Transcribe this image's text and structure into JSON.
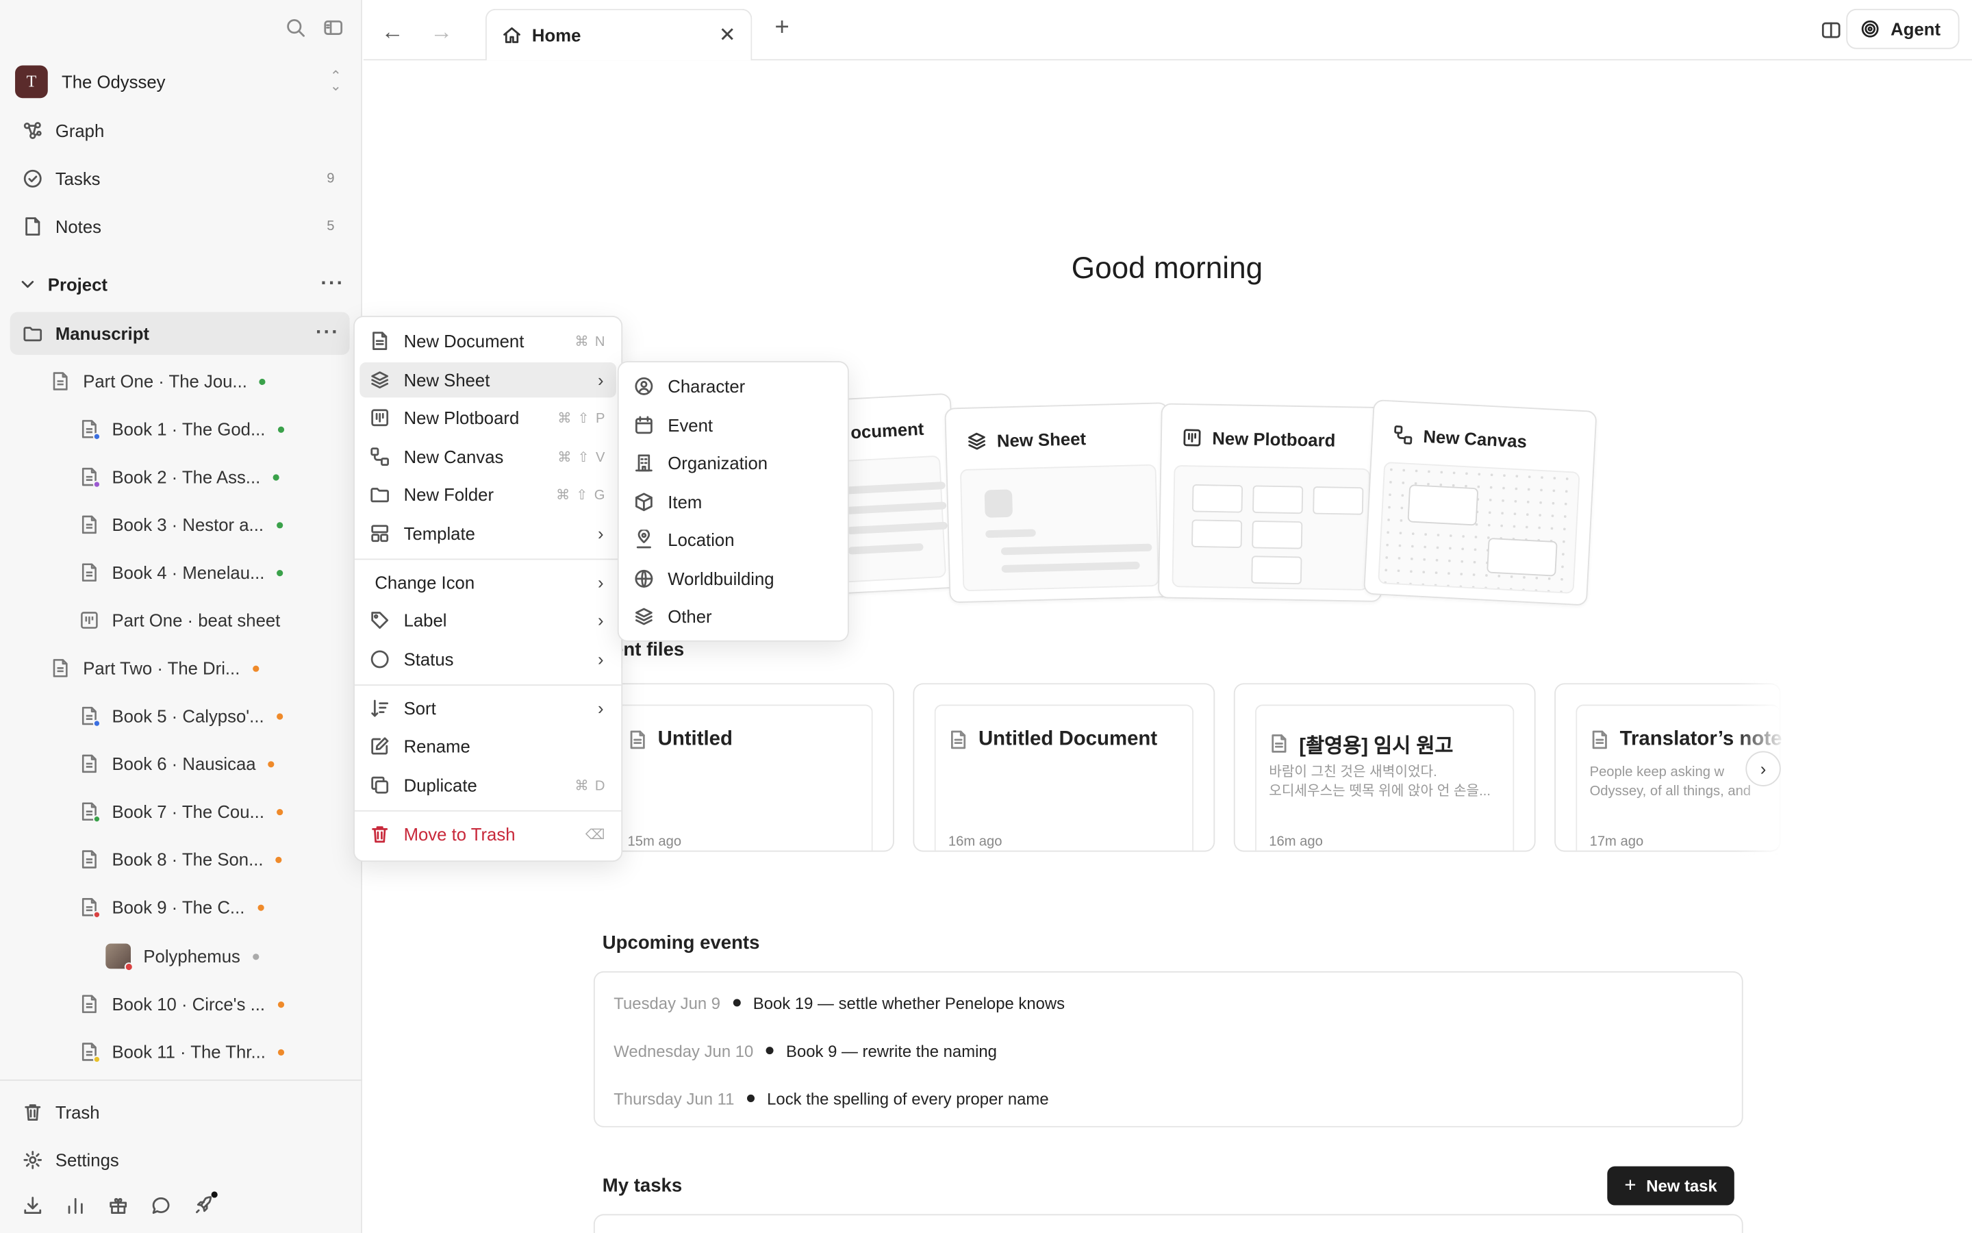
{
  "workspace": {
    "initial": "T",
    "name": "The Odyssey"
  },
  "nav": {
    "graph": "Graph",
    "tasks": "Tasks",
    "tasks_count": "9",
    "notes": "Notes",
    "notes_count": "5"
  },
  "project": {
    "title": "Project",
    "selected": "Manuscript"
  },
  "tree": [
    {
      "label": "Part One · The Jou...",
      "dot": "#3aa14a",
      "badge": ""
    },
    {
      "label": "Book 1 · The God...",
      "dot": "#3aa14a",
      "badge": "#3b6fe0"
    },
    {
      "label": "Book 2 · The Ass...",
      "dot": "#3aa14a",
      "badge": "#9b59d0"
    },
    {
      "label": "Book 3 · Nestor a...",
      "dot": "#3aa14a",
      "badge": ""
    },
    {
      "label": "Book 4 · Menelau...",
      "dot": "#3aa14a",
      "badge": ""
    },
    {
      "label": "Part One · beat sheet",
      "dot": "",
      "badge": ""
    },
    {
      "label": "Part Two · The Dri...",
      "dot": "#ef8a2a",
      "badge": ""
    },
    {
      "label": "Book 5 · Calypso'...",
      "dot": "#ef8a2a",
      "badge": "#3b6fe0"
    },
    {
      "label": "Book 6 · Nausicaa",
      "dot": "#ef8a2a",
      "badge": ""
    },
    {
      "label": "Book 7 · The Cou...",
      "dot": "#ef8a2a",
      "badge": "#3aa14a"
    },
    {
      "label": "Book 8 · The Son...",
      "dot": "#ef8a2a",
      "badge": ""
    },
    {
      "label": "Book 9 · The C...",
      "dot": "#ef8a2a",
      "badge": "#d94141"
    },
    {
      "label": "Polyphemus",
      "dot": "#aaaaaa",
      "badge": ""
    },
    {
      "label": "Book 10 · Circe's ...",
      "dot": "#ef8a2a",
      "badge": ""
    },
    {
      "label": "Book 11 · The Thr...",
      "dot": "#ef8a2a",
      "badge": "#e8c12a"
    }
  ],
  "sidebar_footer": {
    "trash": "Trash",
    "settings": "Settings"
  },
  "tab": {
    "label": "Home"
  },
  "agent_label": "Agent",
  "greeting": "Good morning",
  "create_cards": {
    "document": "ocument",
    "sheet": "New Sheet",
    "plotboard": "New Plotboard",
    "canvas": "New Canvas"
  },
  "recent": {
    "title": "cent files",
    "files": [
      {
        "title": "Untitled",
        "snippet1": "",
        "snippet2": "",
        "time": "15m ago"
      },
      {
        "title": "Untitled Document",
        "snippet1": "",
        "snippet2": "",
        "time": "16m ago"
      },
      {
        "title": "[촬영용] 임시 원고",
        "snippet1": "바람이 그친 것은 새벽이었다.",
        "snippet2": "오디세우스는 뗏목 위에 앉아 언 손을...",
        "time": "16m ago"
      },
      {
        "title": "Translator’s note",
        "snippet1": "People keep asking w",
        "snippet2": "Odyssey, of all things, and",
        "time": "17m ago"
      }
    ]
  },
  "events": {
    "title": "Upcoming events",
    "items": [
      {
        "date": "Tuesday Jun 9",
        "text": "Book 19 — settle whether Penelope knows"
      },
      {
        "date": "Wednesday Jun 10",
        "text": "Book 9 — rewrite the naming"
      },
      {
        "date": "Thursday Jun 11",
        "text": "Lock the spelling of every proper name"
      }
    ]
  },
  "tasks": {
    "title": "My tasks",
    "new_task": "New task"
  },
  "context_menu": {
    "new_document": "New Document",
    "new_document_sc": "⌘ N",
    "new_sheet": "New Sheet",
    "new_plotboard": "New Plotboard",
    "new_plotboard_sc": "⌘ ⇧ P",
    "new_canvas": "New Canvas",
    "new_canvas_sc": "⌘ ⇧ V",
    "new_folder": "New Folder",
    "new_folder_sc": "⌘ ⇧ G",
    "template": "Template",
    "change_icon": "Change Icon",
    "label": "Label",
    "status": "Status",
    "sort": "Sort",
    "rename": "Rename",
    "duplicate": "Duplicate",
    "duplicate_sc": "⌘ D",
    "move_to_trash": "Move to Trash",
    "move_to_trash_sc": "⌫"
  },
  "submenu": {
    "character": "Character",
    "event": "Event",
    "organization": "Organization",
    "item": "Item",
    "location": "Location",
    "worldbuilding": "Worldbuilding",
    "other": "Other"
  },
  "colors": {
    "accent_dark": "#1e1e1e",
    "danger": "#c8283a",
    "green": "#3aa14a",
    "orange": "#ef8a2a"
  }
}
